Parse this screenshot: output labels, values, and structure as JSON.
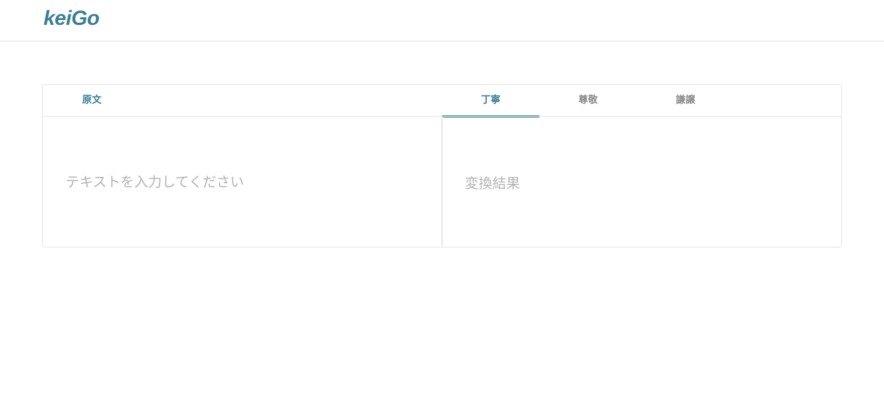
{
  "header": {
    "logo": "keiGo"
  },
  "source_panel": {
    "label": "原文",
    "placeholder": "テキストを入力してください"
  },
  "output_panel": {
    "tabs": [
      {
        "label": "丁寧",
        "active": true
      },
      {
        "label": "尊敬",
        "active": false
      },
      {
        "label": "謙譲",
        "active": false
      }
    ],
    "result_placeholder": "変換結果"
  },
  "colors": {
    "accent": "#3a7f96",
    "inactive_tab": "#8a8a8a",
    "placeholder": "#b3b3b3",
    "border": "#e4e4e4"
  }
}
